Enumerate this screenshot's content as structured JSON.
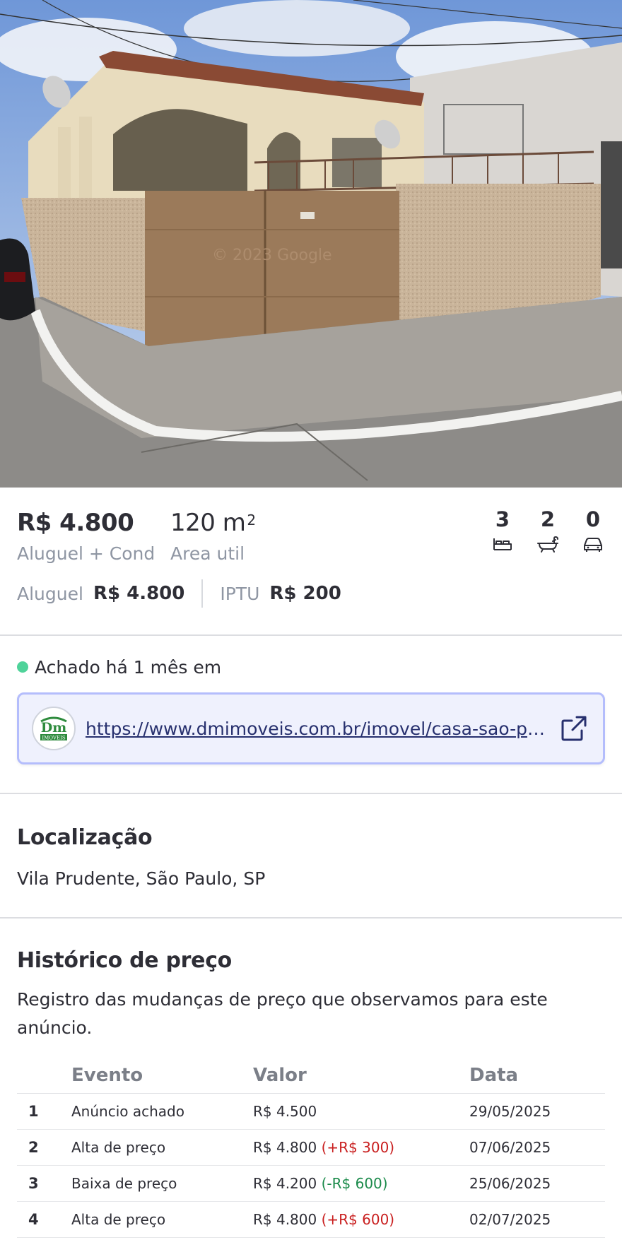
{
  "photo": {
    "alt": "listing-photo",
    "watermark": "© 2023 Google"
  },
  "summary": {
    "price": "R$ 4.800",
    "price_label": "Aluguel + Cond",
    "area_value": "120 m",
    "area_sup": "2",
    "area_label": "Area util",
    "features": [
      {
        "count": "3",
        "icon": "bed-icon"
      },
      {
        "count": "2",
        "icon": "bathtub-icon"
      },
      {
        "count": "0",
        "icon": "car-icon"
      }
    ],
    "rent_label": "Aluguel",
    "rent_value": "R$ 4.800",
    "iptu_label": "IPTU",
    "iptu_value": "R$ 200"
  },
  "found": {
    "status_color": "#4fd39a",
    "text": "Achado há 1 mês em",
    "url": "https://www.dmimoveis.com.br/imovel/casa-sao-paulo-vila-prudente",
    "logo_text": "Dm",
    "logo_sub": "IMOVEIS"
  },
  "location": {
    "title": "Localização",
    "text": "Vila Prudente, São Paulo, SP"
  },
  "history": {
    "title": "Histórico de preço",
    "description": "Registro das mudanças de preço que observamos para este anúncio.",
    "headers": [
      "",
      "Evento",
      "Valor",
      "Data"
    ],
    "rows": [
      {
        "n": "1",
        "event": "Anúncio achado",
        "value": "R$ 4.500",
        "change": "",
        "trend": "",
        "date": "29/05/2025"
      },
      {
        "n": "2",
        "event": "Alta de preço",
        "value": "R$ 4.800",
        "change": "(+R$ 300)",
        "trend": "up",
        "date": "07/06/2025"
      },
      {
        "n": "3",
        "event": "Baixa de preço",
        "value": "R$ 4.200",
        "change": "(-R$ 600)",
        "trend": "down",
        "date": "25/06/2025"
      },
      {
        "n": "4",
        "event": "Alta de preço",
        "value": "R$ 4.800",
        "change": "(+R$ 600)",
        "trend": "up",
        "date": "02/07/2025"
      }
    ]
  }
}
